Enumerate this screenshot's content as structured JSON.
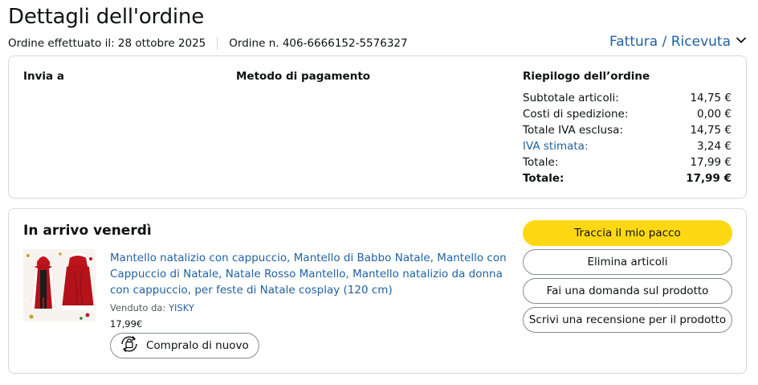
{
  "page": {
    "title": "Dettagli dell'ordine",
    "order_date": "Ordine effettuato il: 28 ottobre 2025",
    "order_number": "Ordine n. 406-6666152-5576327",
    "invoice_link": "Fattura / Ricevuta",
    "invoice_icon": "chevron-down-icon"
  },
  "details": {
    "ship_to_heading": "Invia a",
    "payment_heading": "Metodo di pagamento",
    "summary_heading": "Riepilogo dell’ordine",
    "summary_rows": [
      {
        "label": "Subtotale articoli:",
        "value": "14,75 €"
      },
      {
        "label": "Costi di spedizione:",
        "value": "0,00 €"
      },
      {
        "label": "Totale IVA esclusa:",
        "value": "14,75 €"
      },
      {
        "label": "IVA stimata:",
        "value": "3,24 €"
      },
      {
        "label": "Totale:",
        "value": "17,99 €"
      },
      {
        "label": "Totale:",
        "value": "17,99 €"
      }
    ]
  },
  "shipment": {
    "status": "In arrivo venerdì",
    "product": {
      "title": "Mantello natalizio con cappuccio, Mantello di Babbo Natale, Mantello con Cappuccio di Natale, Natale Rosso Mantello, Mantello natalizio da donna con cappuccio, per feste di Natale cosplay (120 cm)",
      "seller_label": "Venduto da:",
      "seller_name": "YISKY",
      "price": "17,99€",
      "rebuy_label": "Compralo di nuovo",
      "rebuy_icon": "buy-again-icon"
    },
    "actions": {
      "track": "Traccia il mio pacco",
      "delete": "Elimina articoli",
      "question": "Fai una domanda sul prodotto",
      "review": "Scrivi una recensione per il prodotto"
    }
  },
  "colors": {
    "link": "#2162a1",
    "primary_button": "#ffd814",
    "border": "#d5d9d9",
    "text": "#0f1111"
  }
}
